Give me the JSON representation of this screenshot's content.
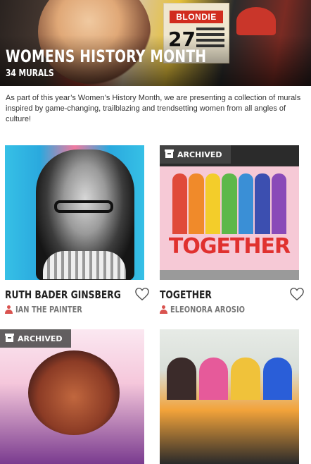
{
  "hero": {
    "title": "WOMENS HISTORY MONTH",
    "subtitle": "34 MURALS",
    "poster_title": "BLONDIE",
    "poster_number": "27"
  },
  "intro": "As part of this year’s Women’s History Month, we are presenting a collection of murals inspired by game-changing, trailblazing and trendsetting women from all angles of culture!",
  "cards": [
    {
      "title": "RUTH BADER GINSBERG",
      "artist": "IAN THE PAINTER",
      "archived": false
    },
    {
      "title": "TOGETHER",
      "artist": "ELEONORA AROSIO",
      "archived": true,
      "badge": "ARCHIVED",
      "mural_text": "TOGETHER"
    },
    {
      "title": "",
      "artist": "",
      "archived": true,
      "badge": "ARCHIVED"
    },
    {
      "title": "",
      "artist": "",
      "archived": false
    }
  ],
  "colors": {
    "artist_icon": "#d9534f",
    "badge_bg": "#464646",
    "together_text": "#e0312f"
  },
  "icons": {
    "favorite": "heart-outline-icon",
    "archived": "archive-box-icon",
    "artist": "person-icon"
  }
}
